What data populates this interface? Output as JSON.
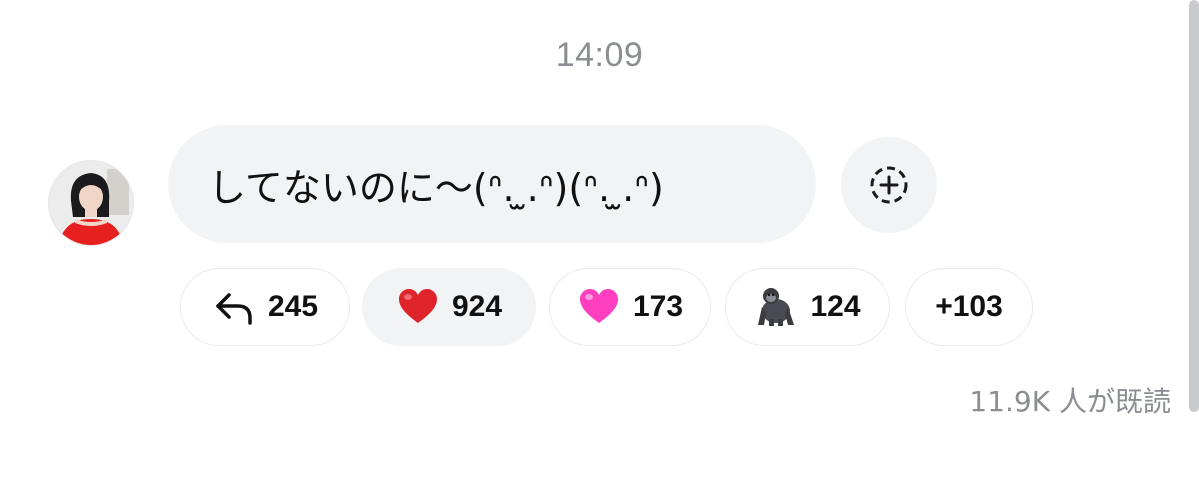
{
  "chat": {
    "timestamp": "14:09",
    "message": {
      "text": "してないのに〜(ᐢ. ̫.ᐢ)(ᐢ. ̫.ᐢ)"
    },
    "reactions": [
      {
        "icon": "reply-arrow-icon",
        "count": "245"
      },
      {
        "icon": "red-heart-icon",
        "color": "#e0242b",
        "count": "924",
        "active": true
      },
      {
        "icon": "pink-heart-icon",
        "color": "#ff3fc0",
        "count": "173"
      },
      {
        "icon": "gorilla-icon",
        "color": "#4a4a52",
        "count": "124"
      },
      {
        "icon": "more-reactions",
        "count": "+103"
      }
    ],
    "read_receipt": "11.9K 人が既読"
  },
  "colors": {
    "bubble_bg": "#f2f3f5",
    "muted_text": "#8a8d92",
    "avatar_dress": "#e81f1f"
  }
}
